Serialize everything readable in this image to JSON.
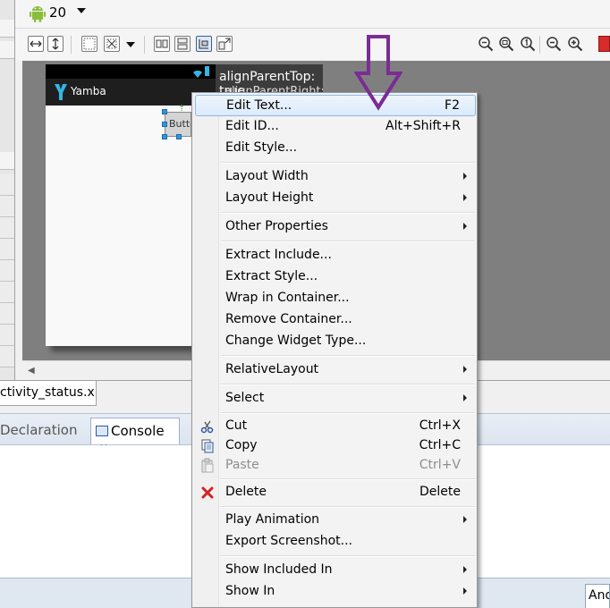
{
  "toolbar": {
    "api_level": "20",
    "icons": [
      "android-icon",
      "dropdown-arrow-icon"
    ]
  },
  "toolbar2": {
    "layout_buttons": [
      "fit-width-icon",
      "fit-height-icon",
      "grid-icon",
      "margins-icon",
      "layout-dropdown-icon",
      "center-h-icon",
      "center-v-icon",
      "align-icon",
      "distribute-icon"
    ],
    "zoom_buttons": [
      "zoom-out-icon",
      "zoom-real-size-icon",
      "zoom-1to1-icon",
      "zoom-minus-icon",
      "zoom-plus-icon"
    ]
  },
  "device": {
    "app_name": "Yamba",
    "button_text": "Butto"
  },
  "tooltip": {
    "line1": "alignParentTop: true",
    "line2": "alignParentRight: t"
  },
  "file_tab": {
    "label": "ctivity_status.xml"
  },
  "bottom_panel": {
    "tabs": [
      {
        "label": "Declaration"
      },
      {
        "label": "Console",
        "close": "✕"
      }
    ],
    "status_button": "And"
  },
  "context_menu": {
    "items": [
      {
        "label": "Edit Text...",
        "shortcut": "F2",
        "highlighted": true
      },
      {
        "label": "Edit ID...",
        "shortcut": "Alt+Shift+R"
      },
      {
        "label": "Edit Style..."
      },
      {
        "label": "Layout Width",
        "submenu": true
      },
      {
        "label": "Layout Height",
        "submenu": true
      },
      {
        "label": "Other Properties",
        "submenu": true
      },
      {
        "label": "Extract Include..."
      },
      {
        "label": "Extract Style..."
      },
      {
        "label": "Wrap in Container..."
      },
      {
        "label": "Remove Container..."
      },
      {
        "label": "Change Widget Type..."
      },
      {
        "label": "RelativeLayout",
        "submenu": true
      },
      {
        "label": "Select",
        "submenu": true
      },
      {
        "label": "Cut",
        "shortcut": "Ctrl+X",
        "icon": "scissors-icon"
      },
      {
        "label": "Copy",
        "shortcut": "Ctrl+C",
        "icon": "copy-icon"
      },
      {
        "label": "Paste",
        "shortcut": "Ctrl+V",
        "icon": "paste-icon",
        "disabled": true
      },
      {
        "label": "Delete",
        "shortcut": "Delete",
        "icon": "delete-icon"
      },
      {
        "label": "Play Animation",
        "submenu": true
      },
      {
        "label": "Export Screenshot..."
      },
      {
        "label": "Show Included In",
        "submenu": true
      },
      {
        "label": "Show In",
        "submenu": true
      }
    ]
  },
  "colors": {
    "highlight_border": "#8eb7e8",
    "annotation_arrow": "#7b2c94",
    "delete_icon": "#d42020",
    "selection_handle": "#2f97e0"
  }
}
